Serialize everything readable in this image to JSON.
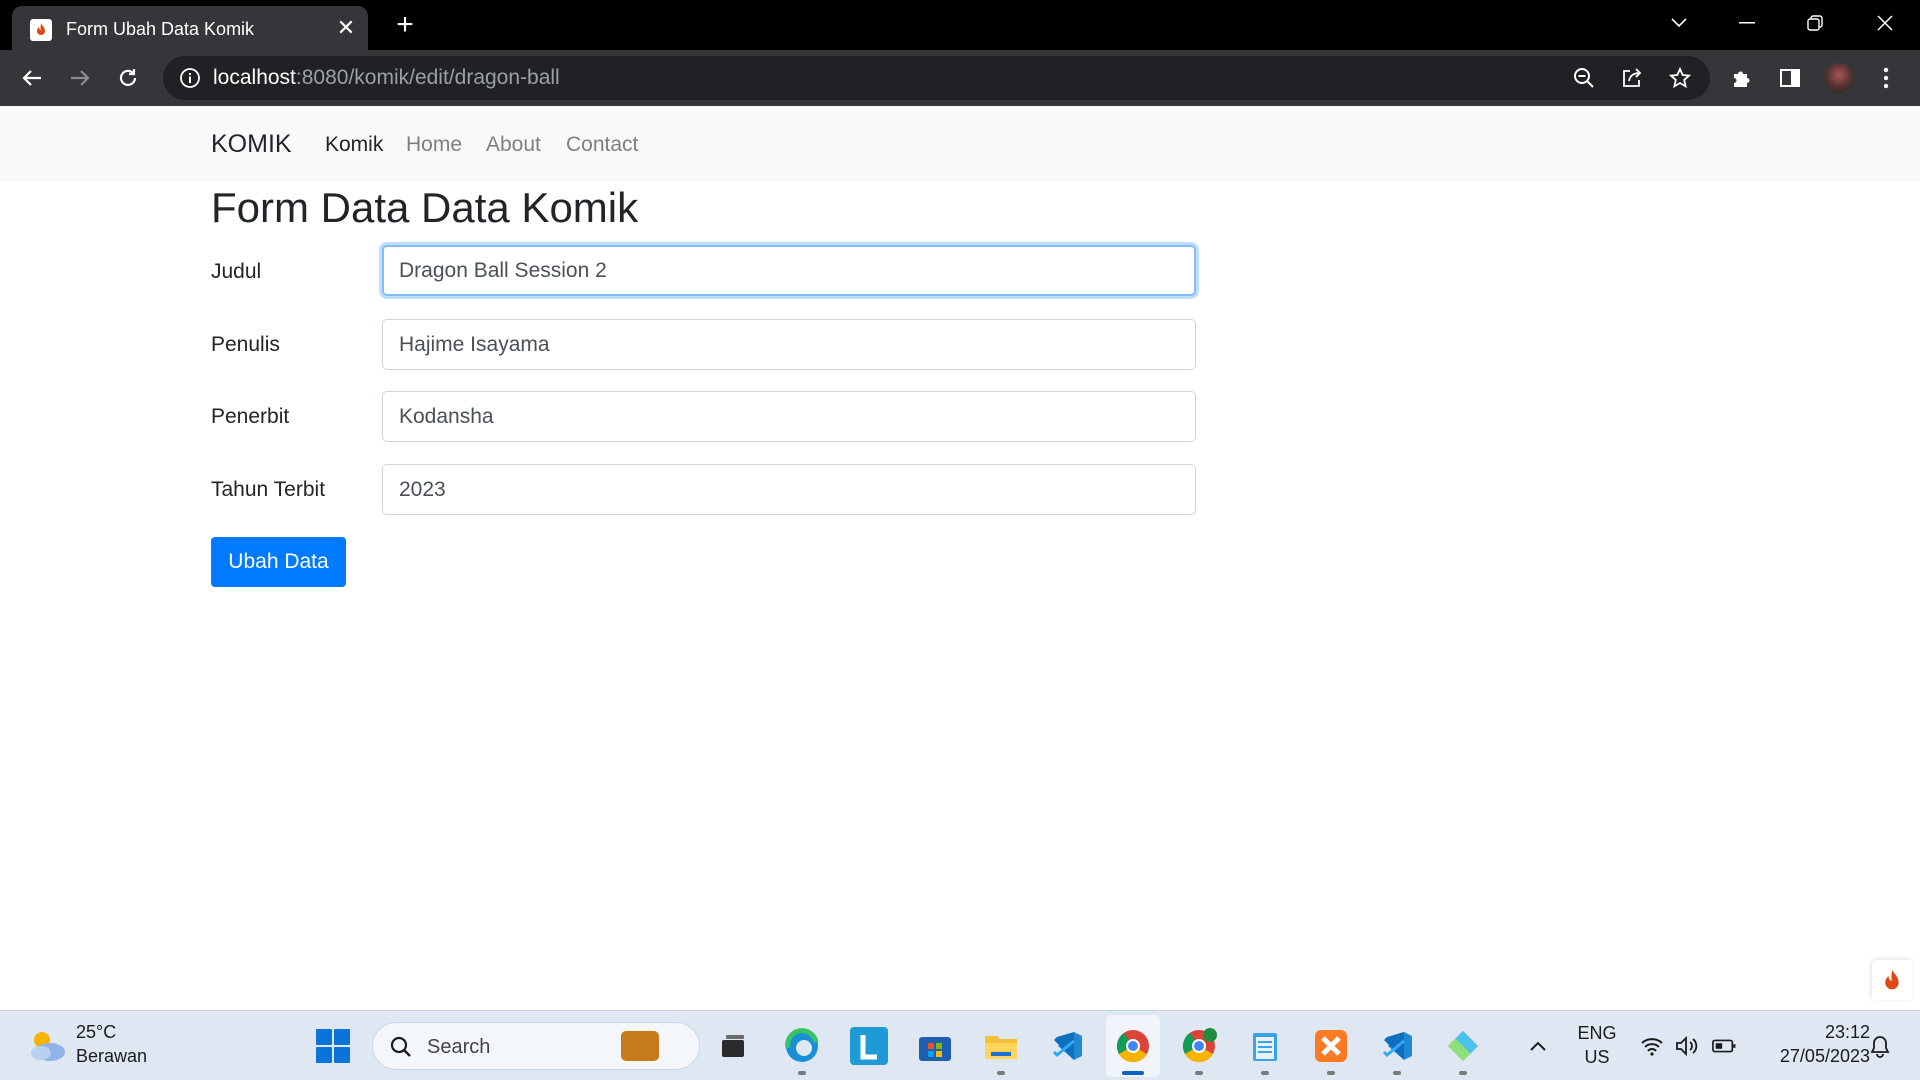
{
  "browser": {
    "tab_title": "Form Ubah Data Komik",
    "url_host": "localhost",
    "url_path": ":8080/komik/edit/dragon-ball"
  },
  "navbar": {
    "brand": "KOMIK",
    "links": [
      "Komik",
      "Home",
      "About",
      "Contact"
    ]
  },
  "page": {
    "title": "Form Data Data Komik",
    "fields": [
      {
        "label": "Judul",
        "value": "Dragon Ball Session 2"
      },
      {
        "label": "Penulis",
        "value": "Hajime Isayama"
      },
      {
        "label": "Penerbit",
        "value": "Kodansha"
      },
      {
        "label": "Tahun Terbit",
        "value": "2023"
      }
    ],
    "submit_label": "Ubah Data"
  },
  "taskbar": {
    "weather_temp": "25°C",
    "weather_desc": "Berawan",
    "search_label": "Search",
    "lang_top": "ENG",
    "lang_bottom": "US",
    "time": "23:12",
    "date": "27/05/2023"
  },
  "colors": {
    "primary": "#007bff",
    "navbar_bg": "#f8f9fa",
    "chrome_dark": "#35363a"
  }
}
